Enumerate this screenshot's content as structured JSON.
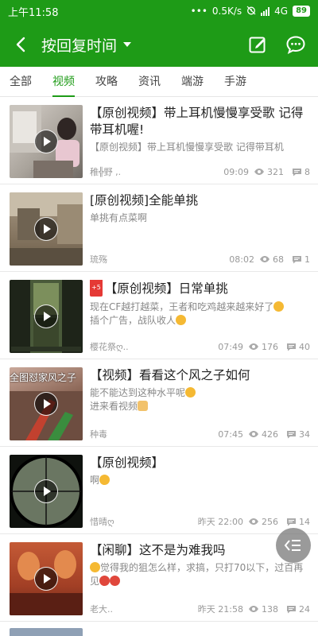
{
  "status_bar": {
    "time": "上午11:58",
    "dots": "•••",
    "speed": "0.5K/s",
    "network": "4G",
    "battery": "89"
  },
  "header": {
    "title": "按回复时间"
  },
  "tabs": [
    {
      "label": "全部",
      "active": false
    },
    {
      "label": "视频",
      "active": true
    },
    {
      "label": "攻略",
      "active": false
    },
    {
      "label": "资讯",
      "active": false
    },
    {
      "label": "端游",
      "active": false
    },
    {
      "label": "手游",
      "active": false
    }
  ],
  "posts": [
    {
      "title": "【原创视频】带上耳机慢慢享受歌 记得带耳机喔!",
      "excerpt": "【原创视频】带上耳机慢慢享受歌 记得带耳机",
      "author": "稚╬野 ,.",
      "time": "09:09",
      "views": "321",
      "comments": "8",
      "thumb_bg": "#b9b2ac"
    },
    {
      "title": "[原创视频]全能单挑",
      "excerpt": "单挑有点菜啊",
      "author": "琉殇",
      "time": "08:02",
      "views": "68",
      "comments": "1",
      "thumb_bg": "#8c7d69"
    },
    {
      "badge": "+5",
      "title": "【原创视频】日常单挑",
      "excerpt": "现在CF越打越菜，王者和吃鸡越来越来好了",
      "excerpt2": "插个广告，战队收人",
      "author": "樱花祭ღ..",
      "time": "07:49",
      "views": "176",
      "comments": "40",
      "thumb_bg": "#2f3b2a"
    },
    {
      "title": "【视频】看看这个风之子如何",
      "excerpt": "能不能达到这种水平呢",
      "excerpt2": "进来看视频",
      "author": "种毒",
      "time": "07:45",
      "views": "426",
      "comments": "34",
      "thumb_caption": "全图怼家风之子",
      "thumb_bg": "#7d6152"
    },
    {
      "title": "【原创视频】",
      "excerpt": "啊",
      "author": "惜晴ღ",
      "time": "昨天 22:00",
      "views": "256",
      "comments": "14",
      "thumb_bg": "#4a5346"
    },
    {
      "title": "【闲聊】这不是为难我吗",
      "excerpt": "觉得我的狙怎么样，求搞，只打70以下，过百再见",
      "author": "老大..",
      "time": "昨天 21:58",
      "views": "138",
      "comments": "24",
      "thumb_bg": "#a8472d"
    }
  ],
  "colors": {
    "brand_green": "#1e9b17",
    "badge_red": "#e53935"
  }
}
